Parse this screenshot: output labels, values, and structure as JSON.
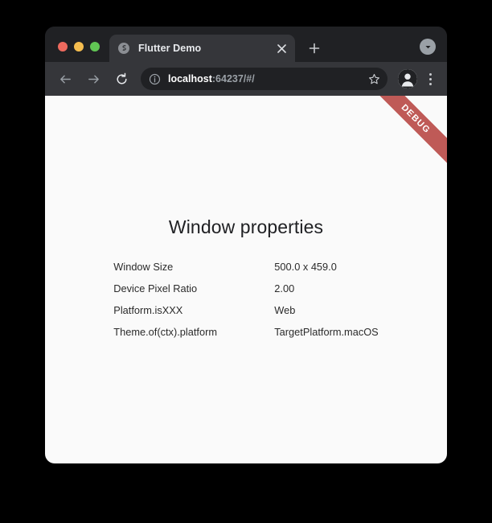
{
  "window": {
    "traffic_lights": [
      {
        "name": "close",
        "color": "#ed6a5e"
      },
      {
        "name": "minimize",
        "color": "#f5bd4f"
      },
      {
        "name": "maximize",
        "color": "#61c554"
      }
    ]
  },
  "tab_strip": {
    "tab": {
      "title": "Flutter Demo",
      "favicon": "globe-icon",
      "close_icon": "close-icon"
    },
    "new_tab_icon": "plus-icon",
    "tab_list_icon": "chevron-down-icon"
  },
  "toolbar": {
    "back_icon": "arrow-left-icon",
    "forward_icon": "arrow-right-icon",
    "reload_icon": "reload-icon",
    "site_info_icon": "info-circle-icon",
    "url_host": "localhost",
    "url_rest": ":64237/#/",
    "url_full": "localhost:64237/#/",
    "bookmark_icon": "star-icon",
    "profile_icon": "person-icon",
    "menu_icon": "three-dots-icon"
  },
  "page": {
    "debug_banner": "DEBUG",
    "debug_color": "#bf5a57",
    "title": "Window properties",
    "properties": [
      {
        "label": "Window Size",
        "value": "500.0 x 459.0"
      },
      {
        "label": "Device Pixel Ratio",
        "value": "2.00"
      },
      {
        "label": "Platform.isXXX",
        "value": "Web"
      },
      {
        "label": "Theme.of(ctx).platform",
        "value": "TargetPlatform.macOS"
      }
    ]
  }
}
